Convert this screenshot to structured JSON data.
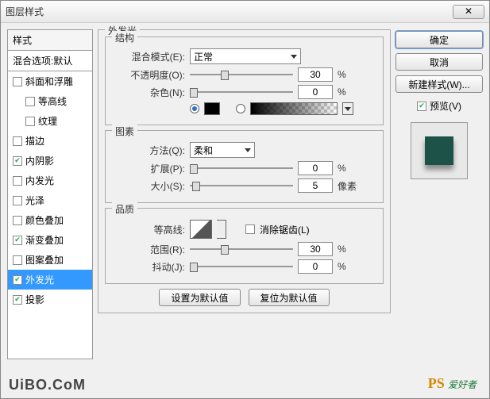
{
  "title": "图层样式",
  "close_icon": "✕",
  "left": {
    "header": "样式",
    "sub": "混合选项:默认",
    "items": [
      {
        "label": "斜面和浮雕",
        "checked": false,
        "indent": false
      },
      {
        "label": "等高线",
        "checked": false,
        "indent": true
      },
      {
        "label": "纹理",
        "checked": false,
        "indent": true
      },
      {
        "label": "描边",
        "checked": false,
        "indent": false
      },
      {
        "label": "内阴影",
        "checked": true,
        "indent": false
      },
      {
        "label": "内发光",
        "checked": false,
        "indent": false
      },
      {
        "label": "光泽",
        "checked": false,
        "indent": false
      },
      {
        "label": "颜色叠加",
        "checked": false,
        "indent": false
      },
      {
        "label": "渐变叠加",
        "checked": true,
        "indent": false
      },
      {
        "label": "图案叠加",
        "checked": false,
        "indent": false
      },
      {
        "label": "外发光",
        "checked": true,
        "indent": false,
        "selected": true
      },
      {
        "label": "投影",
        "checked": true,
        "indent": false
      }
    ]
  },
  "center": {
    "outer_title": "外发光",
    "struct": {
      "title": "结构",
      "blend_label": "混合模式(E):",
      "blend_value": "正常",
      "opacity_label": "不透明度(O):",
      "opacity_value": "30",
      "opacity_unit": "%",
      "noise_label": "杂色(N):",
      "noise_value": "0",
      "noise_unit": "%"
    },
    "element": {
      "title": "图素",
      "method_label": "方法(Q):",
      "method_value": "柔和",
      "spread_label": "扩展(P):",
      "spread_value": "0",
      "spread_unit": "%",
      "size_label": "大小(S):",
      "size_value": "5",
      "size_unit": "像素"
    },
    "quality": {
      "title": "品质",
      "contour_label": "等高线:",
      "antialias_label": "消除锯齿(L)",
      "range_label": "范围(R):",
      "range_value": "30",
      "range_unit": "%",
      "jitter_label": "抖动(J):",
      "jitter_value": "0",
      "jitter_unit": "%"
    },
    "default_btn": "设置为默认值",
    "reset_btn": "复位为默认值"
  },
  "right": {
    "ok": "确定",
    "cancel": "取消",
    "new_style": "新建样式(W)...",
    "preview": "预览(V)"
  },
  "watermark1": "UiBO.CoM",
  "watermark2_a": "PS",
  "watermark2_b": "爱好者"
}
